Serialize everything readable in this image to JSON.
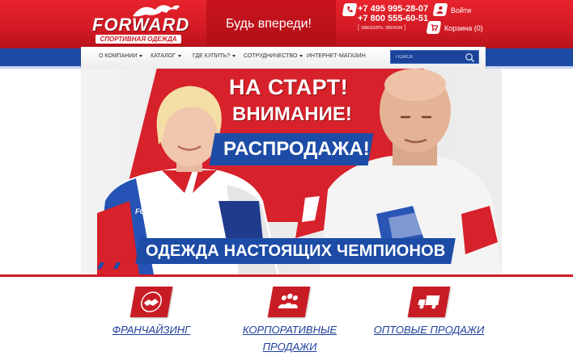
{
  "header": {
    "logo_text": "FORWARD",
    "logo_subtitle": "СПОРТИВНАЯ ОДЕЖДА",
    "slogan": "Будь впереди!",
    "phone_1": "+7 495 995-28-07",
    "phone_2": "+7 800 555-60-51",
    "callback_link": "[ заказать звонок ]",
    "login_label": "Войти",
    "cart_label": "Корзина (0)"
  },
  "nav": {
    "items": [
      {
        "label": "О КОМПАНИИ",
        "has_dropdown": true
      },
      {
        "label": "КАТАЛОГ",
        "has_dropdown": true
      },
      {
        "label": "ГДЕ КУПИТЬ?",
        "has_dropdown": true
      },
      {
        "label": "СОТРУДНИЧЕСТВО",
        "has_dropdown": true
      },
      {
        "label": "ИНТЕРНЕТ-МАГАЗИН",
        "has_dropdown": false
      }
    ],
    "search_placeholder": "ПОИСК"
  },
  "banner": {
    "headline_1": "НА СТАРТ!",
    "headline_2": "ВНИМАНИЕ!",
    "headline_3": "РАСПРОДАЖА!",
    "slogan": "ОДЕЖДА НАСТОЯЩИХ ЧЕМПИОНОВ",
    "shirt_brand": "FORWARD"
  },
  "features": [
    {
      "label_line1": "ФРАНЧАЙЗИНГ",
      "label_line2": "",
      "icon": "handshake-icon"
    },
    {
      "label_line1": "КОРПОРАТИВНЫЕ",
      "label_line2": "ПРОДАЖИ",
      "icon": "team-icon"
    },
    {
      "label_line1": "ОПТОВЫЕ ПРОДАЖИ",
      "label_line2": "",
      "icon": "delivery-truck-icon"
    }
  ],
  "colors": {
    "brand_red": "#d21a24",
    "brand_blue": "#1d4ca6",
    "link_blue": "#1d3f9c"
  }
}
